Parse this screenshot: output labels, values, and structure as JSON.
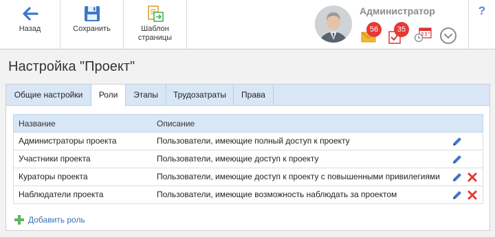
{
  "toolbar": {
    "back_label": "Назад",
    "save_label": "Сохранить",
    "template_label_line1": "Шаблон",
    "template_label_line2": "страницы"
  },
  "user": {
    "name": "Администратор",
    "messages_count": "56",
    "tasks_count": "35"
  },
  "help": {
    "label": "?"
  },
  "page": {
    "title": "Настройка \"Проект\""
  },
  "tabs": [
    {
      "label": "Общие настройки",
      "active": false
    },
    {
      "label": "Роли",
      "active": true
    },
    {
      "label": "Этапы",
      "active": false
    },
    {
      "label": "Трудозатраты",
      "active": false
    },
    {
      "label": "Права",
      "active": false
    }
  ],
  "grid": {
    "columns": [
      "Название",
      "Описание"
    ],
    "rows": [
      {
        "name": "Администраторы проекта",
        "description": "Пользователи, имеющие полный доступ к проекту",
        "can_delete": false
      },
      {
        "name": "Участники проекта",
        "description": "Пользователи, имеющие доступ к проекту",
        "can_delete": false
      },
      {
        "name": "Кураторы проекта",
        "description": "Пользователи, имеющие доступ к проекту с повышенными привилегиями",
        "can_delete": true
      },
      {
        "name": "Наблюдатели проекта",
        "description": "Пользователи, имеющие возможность наблюдать за проектом",
        "can_delete": true
      }
    ]
  },
  "add_role_label": "Добавить роль",
  "colors": {
    "accent": "#3d6fb0",
    "tab_bar": "#d8e6f5",
    "badge": "#e53935",
    "delete": "#e53935",
    "add": "#5cb85c"
  },
  "icons": {
    "back": "arrow-left-icon",
    "save": "floppy-disk-icon",
    "template": "page-template-icon",
    "messages": "envelope-icon",
    "tasks": "task-check-icon",
    "calendar": "calendar-clock-icon",
    "menu": "chevron-down-icon",
    "edit": "pencil-icon",
    "delete": "delete-x-icon",
    "add": "plus-icon"
  }
}
